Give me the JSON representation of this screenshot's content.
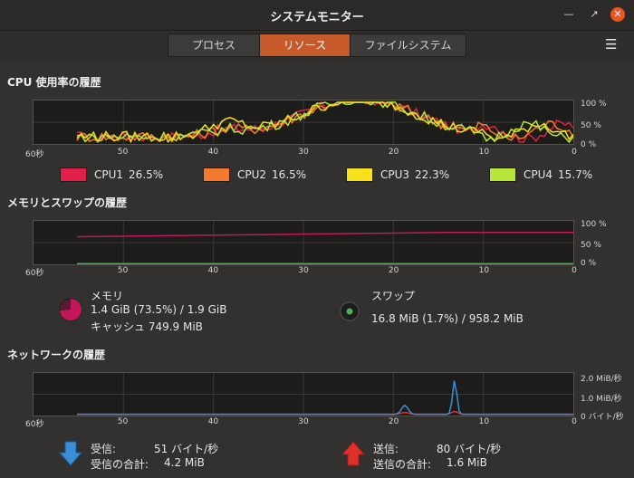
{
  "window": {
    "title": "システムモニター"
  },
  "tabs": [
    {
      "label": "プロセス",
      "active": false
    },
    {
      "label": "リソース",
      "active": true
    },
    {
      "label": "ファイルシステム",
      "active": false
    }
  ],
  "cpu": {
    "title": "CPU 使用率の履歴",
    "axis_right": [
      "100 %",
      "50 %",
      "0 %"
    ],
    "x_ticks": [
      "60秒",
      "50",
      "40",
      "30",
      "20",
      "10",
      "0"
    ],
    "legend": [
      {
        "name": "CPU1",
        "value": "26.5%",
        "color": "#e0204a"
      },
      {
        "name": "CPU2",
        "value": "16.5%",
        "color": "#f37a2c"
      },
      {
        "name": "CPU3",
        "value": "22.3%",
        "color": "#f6e11b"
      },
      {
        "name": "CPU4",
        "value": "15.7%",
        "color": "#b8e63a"
      }
    ]
  },
  "memory": {
    "title": "メモリとスワップの履歴",
    "axis_right": [
      "100 %",
      "50 %",
      "0 %"
    ],
    "x_ticks": [
      "60秒",
      "50",
      "40",
      "30",
      "20",
      "10",
      "0"
    ],
    "mem_label": "メモリ",
    "mem_value": "1.4 GiB (73.5%) / 1.9 GiB",
    "cache_value": "キャッシュ 749.9 MiB",
    "mem_color": "#c2185b",
    "mem_fraction": 0.735,
    "swap_label": "スワップ",
    "swap_value": "16.8 MiB (1.7%) / 958.2 MiB",
    "swap_color": "#4caf50",
    "swap_fraction": 0.017
  },
  "network": {
    "title": "ネットワークの履歴",
    "axis_right": [
      "2.0 MiB/秒",
      "1.0 MiB/秒",
      "0 バイト/秒"
    ],
    "x_ticks": [
      "60秒",
      "50",
      "40",
      "30",
      "20",
      "10",
      "0"
    ],
    "recv_label": "受信:",
    "recv_value": "51 バイト/秒",
    "recv_total_label": "受信の合計:",
    "recv_total_value": "4.2 MiB",
    "recv_color": "#3a8fd6",
    "send_label": "送信:",
    "send_value": "80 バイト/秒",
    "send_total_label": "送信の合計:",
    "send_total_value": "1.6 MiB",
    "send_color": "#e0302a"
  }
}
